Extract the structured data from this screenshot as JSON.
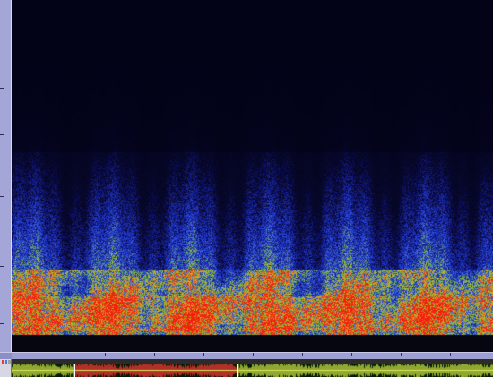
{
  "window": {
    "title": ""
  },
  "frequency_axis": {
    "labels": [
      "",
      "",
      "",
      "",
      "",
      "",
      ""
    ]
  },
  "time_axis": {
    "labels": [
      "",
      "",
      "",
      "",
      "",
      "",
      "",
      "",
      "",
      ""
    ]
  },
  "track": {
    "name": "",
    "selection_start": 0.13,
    "selection_end": 0.47
  },
  "colors": {
    "spectrogram_low": "#090e6a",
    "spectrogram_mid": "#6fb33f",
    "spectrogram_high": "#d73a16",
    "waveform_selected": "#b13128",
    "waveform_unselected": "#8fa831",
    "ruler_bg": "#a4a6d8"
  },
  "icons": [
    "track-record-icon",
    "track-solo-icon",
    "track-mute-icon"
  ]
}
